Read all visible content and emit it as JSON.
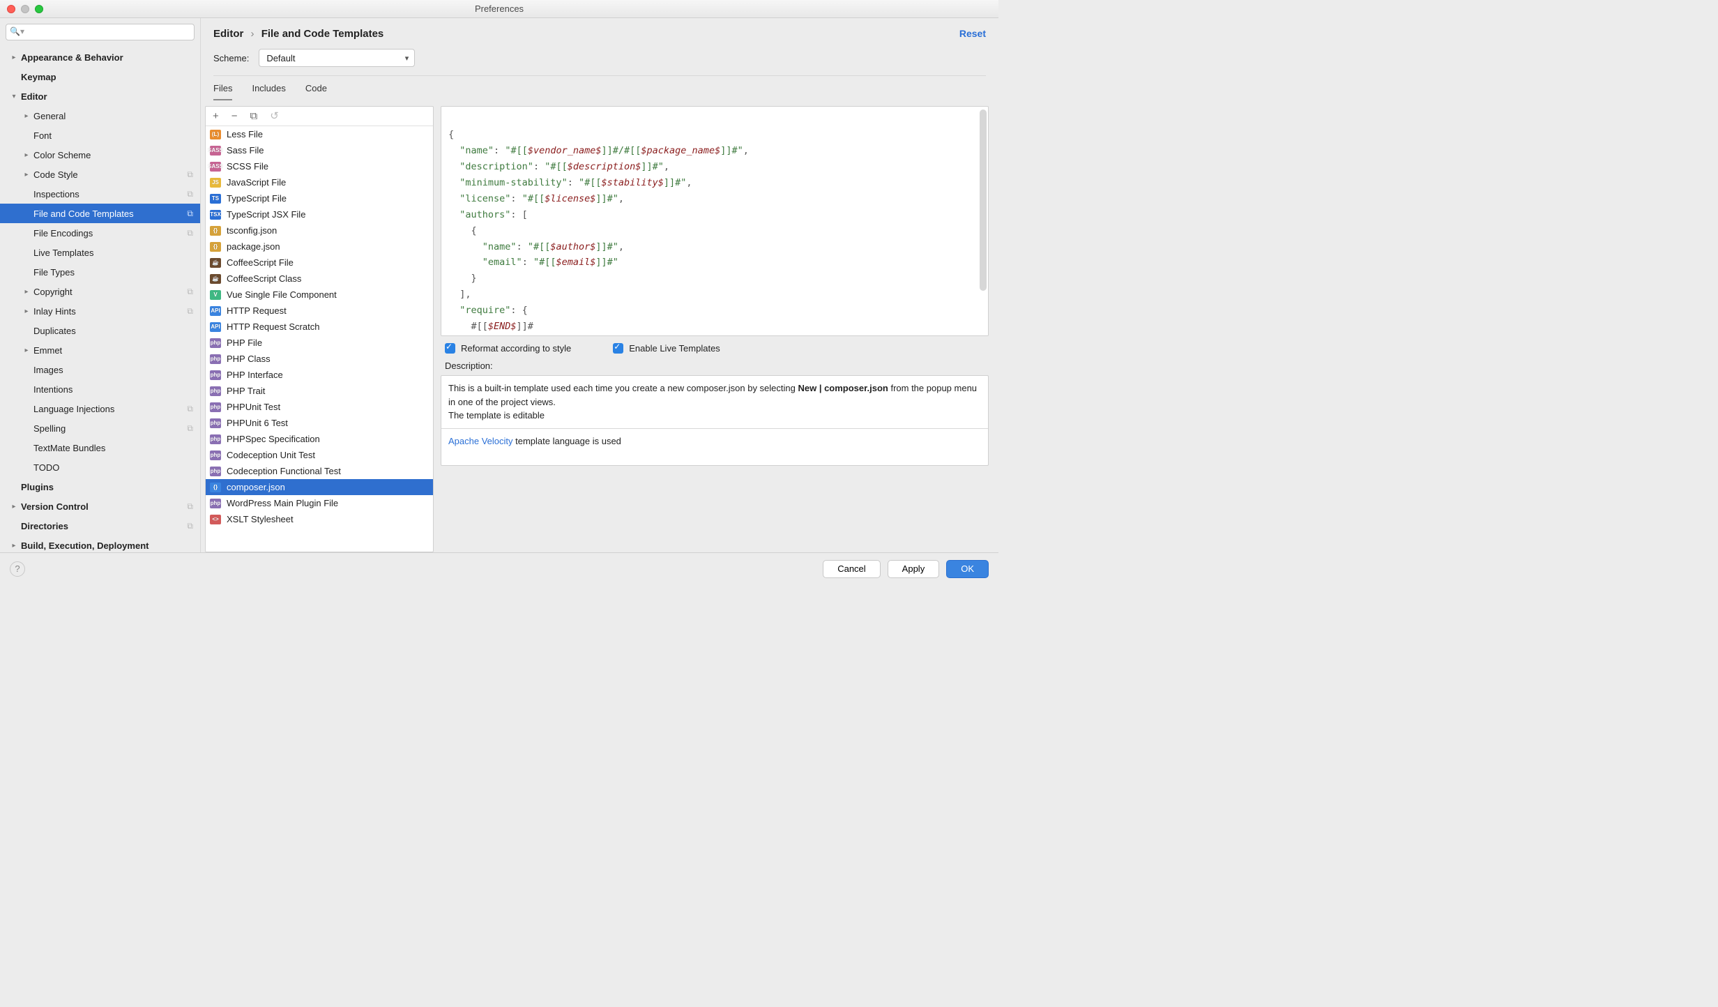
{
  "window": {
    "title": "Preferences"
  },
  "search": {
    "placeholder": ""
  },
  "sidebar": [
    {
      "label": "Appearance & Behavior",
      "indent": 0,
      "arrow": "▸",
      "bold": true
    },
    {
      "label": "Keymap",
      "indent": 0,
      "arrow": "",
      "bold": true
    },
    {
      "label": "Editor",
      "indent": 0,
      "arrow": "▾",
      "bold": true
    },
    {
      "label": "General",
      "indent": 1,
      "arrow": "▸"
    },
    {
      "label": "Font",
      "indent": 1,
      "arrow": ""
    },
    {
      "label": "Color Scheme",
      "indent": 1,
      "arrow": "▸"
    },
    {
      "label": "Code Style",
      "indent": 1,
      "arrow": "▸",
      "copy": true
    },
    {
      "label": "Inspections",
      "indent": 1,
      "arrow": "",
      "copy": true
    },
    {
      "label": "File and Code Templates",
      "indent": 1,
      "arrow": "",
      "copy": true,
      "selected": true
    },
    {
      "label": "File Encodings",
      "indent": 1,
      "arrow": "",
      "copy": true
    },
    {
      "label": "Live Templates",
      "indent": 1,
      "arrow": ""
    },
    {
      "label": "File Types",
      "indent": 1,
      "arrow": ""
    },
    {
      "label": "Copyright",
      "indent": 1,
      "arrow": "▸",
      "copy": true
    },
    {
      "label": "Inlay Hints",
      "indent": 1,
      "arrow": "▸",
      "copy": true
    },
    {
      "label": "Duplicates",
      "indent": 1,
      "arrow": ""
    },
    {
      "label": "Emmet",
      "indent": 1,
      "arrow": "▸"
    },
    {
      "label": "Images",
      "indent": 1,
      "arrow": ""
    },
    {
      "label": "Intentions",
      "indent": 1,
      "arrow": ""
    },
    {
      "label": "Language Injections",
      "indent": 1,
      "arrow": "",
      "copy": true
    },
    {
      "label": "Spelling",
      "indent": 1,
      "arrow": "",
      "copy": true
    },
    {
      "label": "TextMate Bundles",
      "indent": 1,
      "arrow": ""
    },
    {
      "label": "TODO",
      "indent": 1,
      "arrow": ""
    },
    {
      "label": "Plugins",
      "indent": 0,
      "arrow": "",
      "bold": true
    },
    {
      "label": "Version Control",
      "indent": 0,
      "arrow": "▸",
      "bold": true,
      "copy": true
    },
    {
      "label": "Directories",
      "indent": 0,
      "arrow": "",
      "bold": true,
      "copy": true
    },
    {
      "label": "Build, Execution, Deployment",
      "indent": 0,
      "arrow": "▸",
      "bold": true
    }
  ],
  "breadcrumb": {
    "root": "Editor",
    "page": "File and Code Templates"
  },
  "reset_label": "Reset",
  "scheme": {
    "label": "Scheme:",
    "value": "Default"
  },
  "tabs": [
    {
      "label": "Files",
      "active": true
    },
    {
      "label": "Includes"
    },
    {
      "label": "Code"
    }
  ],
  "toolbar_icons": [
    "+",
    "−",
    "⧉",
    "↺"
  ],
  "templates": [
    {
      "label": "Less File",
      "iconText": "(L)",
      "iconColor": "#e98c2e"
    },
    {
      "label": "Sass File",
      "iconText": "SASS",
      "iconColor": "#c76493"
    },
    {
      "label": "SCSS File",
      "iconText": "SASS",
      "iconColor": "#c76493"
    },
    {
      "label": "JavaScript File",
      "iconText": "JS",
      "iconColor": "#e8b93a"
    },
    {
      "label": "TypeScript File",
      "iconText": "TS",
      "iconColor": "#2a6fd6"
    },
    {
      "label": "TypeScript JSX File",
      "iconText": "TSX",
      "iconColor": "#2a6fd6"
    },
    {
      "label": "tsconfig.json",
      "iconText": "{}",
      "iconColor": "#d6a23a"
    },
    {
      "label": "package.json",
      "iconText": "{}",
      "iconColor": "#d6a23a"
    },
    {
      "label": "CoffeeScript File",
      "iconText": "☕",
      "iconColor": "#6b4a2e"
    },
    {
      "label": "CoffeeScript Class",
      "iconText": "☕",
      "iconColor": "#6b4a2e"
    },
    {
      "label": "Vue Single File Component",
      "iconText": "V",
      "iconColor": "#3fb883"
    },
    {
      "label": "HTTP Request",
      "iconText": "API",
      "iconColor": "#3a84e0"
    },
    {
      "label": "HTTP Request Scratch",
      "iconText": "API",
      "iconColor": "#3a84e0"
    },
    {
      "label": "PHP File",
      "iconText": "php",
      "iconColor": "#8a6fb3"
    },
    {
      "label": "PHP Class",
      "iconText": "php",
      "iconColor": "#8a6fb3"
    },
    {
      "label": "PHP Interface",
      "iconText": "php",
      "iconColor": "#8a6fb3"
    },
    {
      "label": "PHP Trait",
      "iconText": "php",
      "iconColor": "#8a6fb3"
    },
    {
      "label": "PHPUnit Test",
      "iconText": "php",
      "iconColor": "#8a6fb3"
    },
    {
      "label": "PHPUnit 6 Test",
      "iconText": "php",
      "iconColor": "#8a6fb3"
    },
    {
      "label": "PHPSpec Specification",
      "iconText": "php",
      "iconColor": "#8a6fb3"
    },
    {
      "label": "Codeception Unit Test",
      "iconText": "php",
      "iconColor": "#8a6fb3"
    },
    {
      "label": "Codeception Functional Test",
      "iconText": "php",
      "iconColor": "#8a6fb3"
    },
    {
      "label": "composer.json",
      "iconText": "{}",
      "iconColor": "#3a84e0",
      "selected": true
    },
    {
      "label": "WordPress Main Plugin File",
      "iconText": "php",
      "iconColor": "#8a6fb3"
    },
    {
      "label": "XSLT Stylesheet",
      "iconText": "<>",
      "iconColor": "#d25a5a"
    }
  ],
  "editor": {
    "l1a": "\"name\"",
    "l1b": "\"#[[",
    "l1v1": "$vendor_name$",
    "l1c": "]]#/#[[",
    "l1v2": "$package_name$",
    "l1d": "]]#\"",
    "l2a": "\"description\"",
    "l2b": "\"#[[",
    "l2v": "$description$",
    "l2c": "]]#\"",
    "l3a": "\"minimum-stability\"",
    "l3b": "\"#[[",
    "l3v": "$stability$",
    "l3c": "]]#\"",
    "l4a": "\"license\"",
    "l4b": "\"#[[",
    "l4v": "$license$",
    "l4c": "]]#\"",
    "l5a": "\"authors\"",
    "l6a": "\"name\"",
    "l6b": "\"#[[",
    "l6v": "$author$",
    "l6c": "]]#\"",
    "l7a": "\"email\"",
    "l7b": "\"#[[",
    "l7v": "$email$",
    "l7c": "]]#\"",
    "l8a": "\"require\"",
    "l9a": "#[[",
    "l9v": "$END$",
    "l9b": "]]#"
  },
  "checks": {
    "reformat": "Reformat according to style",
    "livetpl": "Enable Live Templates"
  },
  "description": {
    "label": "Description:",
    "line1_pre": "This is a built-in template used each time you create a new composer.json by selecting ",
    "line1_bold": "New | composer.json",
    "line2": "from the popup menu in one of the project views.",
    "line3": "The template is editable",
    "link": "Apache Velocity",
    "after_link": " template language is used"
  },
  "footer": {
    "cancel": "Cancel",
    "apply": "Apply",
    "ok": "OK"
  }
}
